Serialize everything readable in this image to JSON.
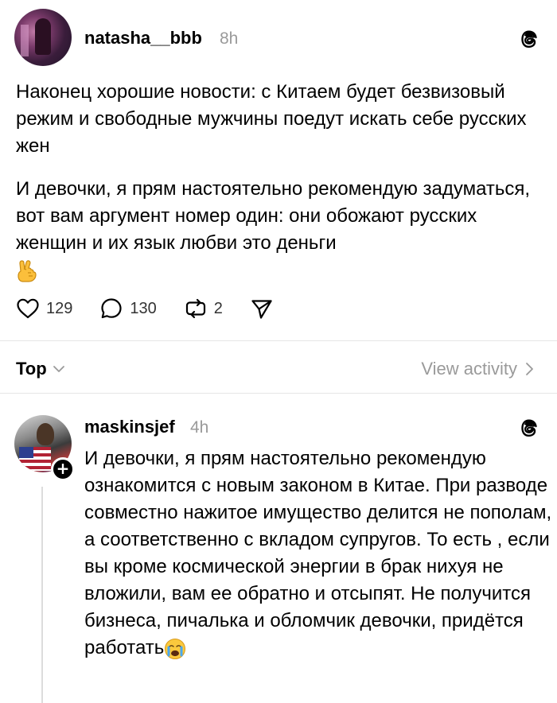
{
  "post": {
    "username": "natasha__bbb",
    "time": "8h",
    "paragraph1": "Наконец хорошие новости: с Китаем будет безвизовый режим и свободные мужчины поедут искать себе русских жен",
    "paragraph2": "И девочки, я прям настоятельно рекомендую задуматься, вот вам аргумент номер один: они обожают русских женщин и их язык любви это деньги",
    "likes": "129",
    "comments": "130",
    "reposts": "2"
  },
  "sort": {
    "label": "Top",
    "view_activity": "View activity"
  },
  "reply": {
    "username": "maskinsjef",
    "time": "4h",
    "text": "И девочки, я прям настоятельно рекомендую ознакомится с новым законом в Китае. При разводе совместно нажитое имущество делится не пополам,  а соответственно с вкладом супругов. То есть , если вы кроме космической энергии в брак нихуя не вложили, вам ее обратно и отсыпят. Не получится бизнеса, пичалька и обломчик девочки, придётся работать",
    "add_badge": "+"
  },
  "icons": {
    "threads": "threads-logo-icon",
    "like": "heart-icon",
    "comment": "comment-bubble-icon",
    "repost": "repost-icon",
    "share": "send-icon",
    "sort_chevron": "chevron-down-icon",
    "activity_chevron": "chevron-right-icon",
    "fingers_crossed": "fingers-crossed-emoji",
    "crying": "crying-face-emoji"
  },
  "colors": {
    "text": "#000000",
    "muted": "#9a9a9a",
    "divider": "#e6e6e6"
  }
}
